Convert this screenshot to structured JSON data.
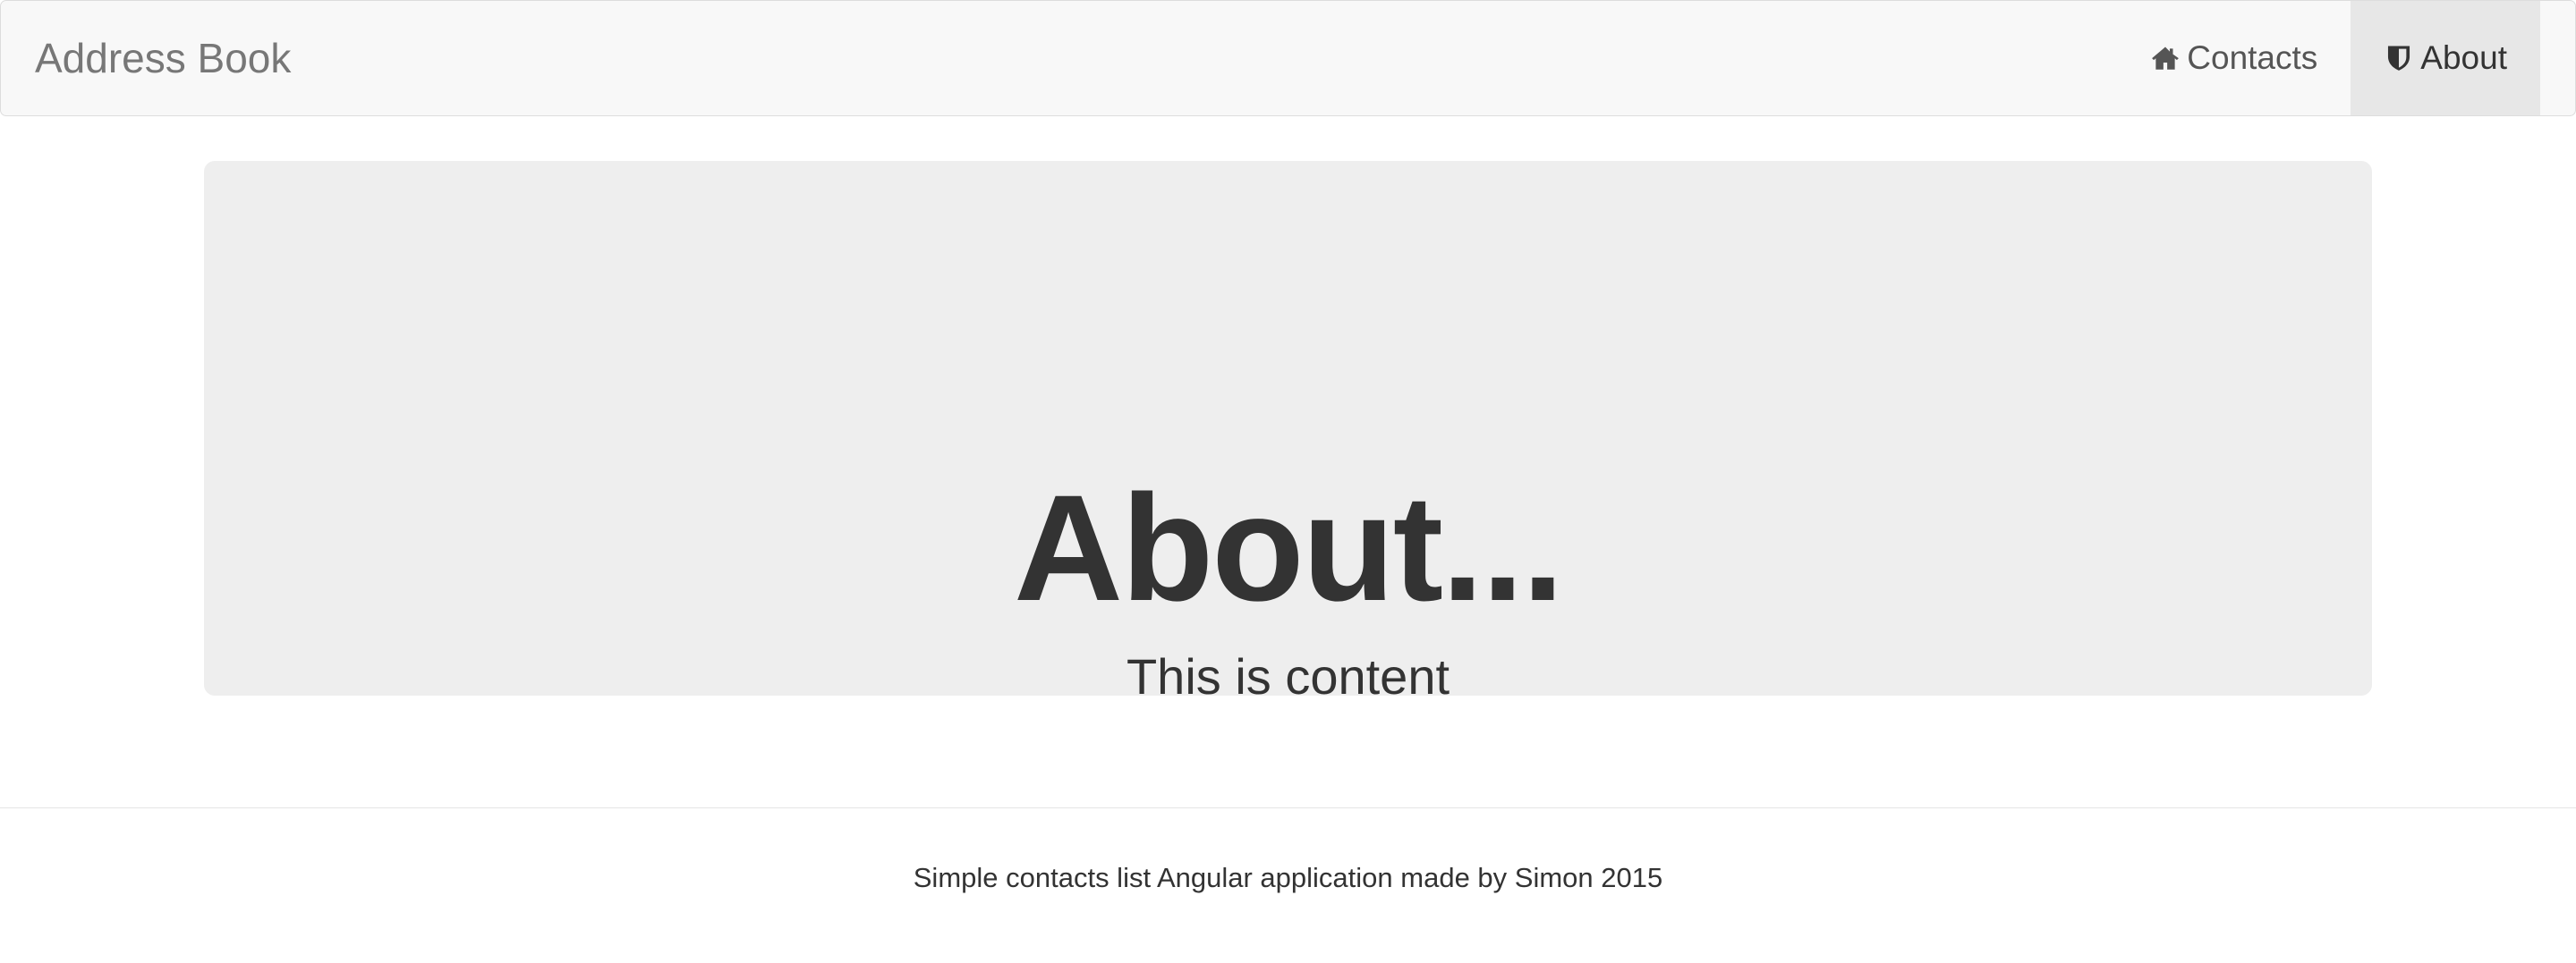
{
  "navbar": {
    "brand": "Address Book",
    "items": [
      {
        "label": "Contacts",
        "icon": "home-icon",
        "active": false
      },
      {
        "label": "About",
        "icon": "shield-icon",
        "active": true
      }
    ]
  },
  "jumbotron": {
    "title": "About...",
    "text": "This is content"
  },
  "footer": {
    "text": "Simple contacts list Angular application made by Simon 2015"
  },
  "colors": {
    "navbar_background": "#f8f8f8",
    "active_nav_background": "#e7e7e7",
    "panel_background": "#eeeeee",
    "text": "#333333",
    "muted_text": "#777777"
  }
}
